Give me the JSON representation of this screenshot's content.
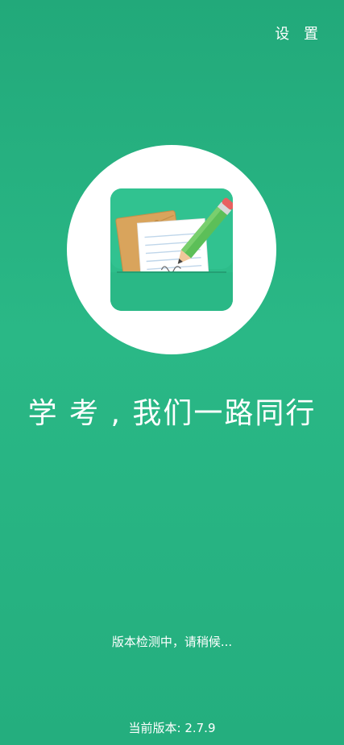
{
  "header": {
    "settings_label": "设 置"
  },
  "splash": {
    "slogan": "学 考 , 我们一路同行",
    "status": "版本检测中，请稍候...",
    "version": "当前版本: 2.7.9"
  },
  "icons": {
    "app_logo": "notebook-pencil-icon"
  },
  "colors": {
    "background": "#27b482",
    "icon_green": "#2ab886",
    "pencil": "#5cbf58",
    "envelope": "#d8a45b"
  }
}
